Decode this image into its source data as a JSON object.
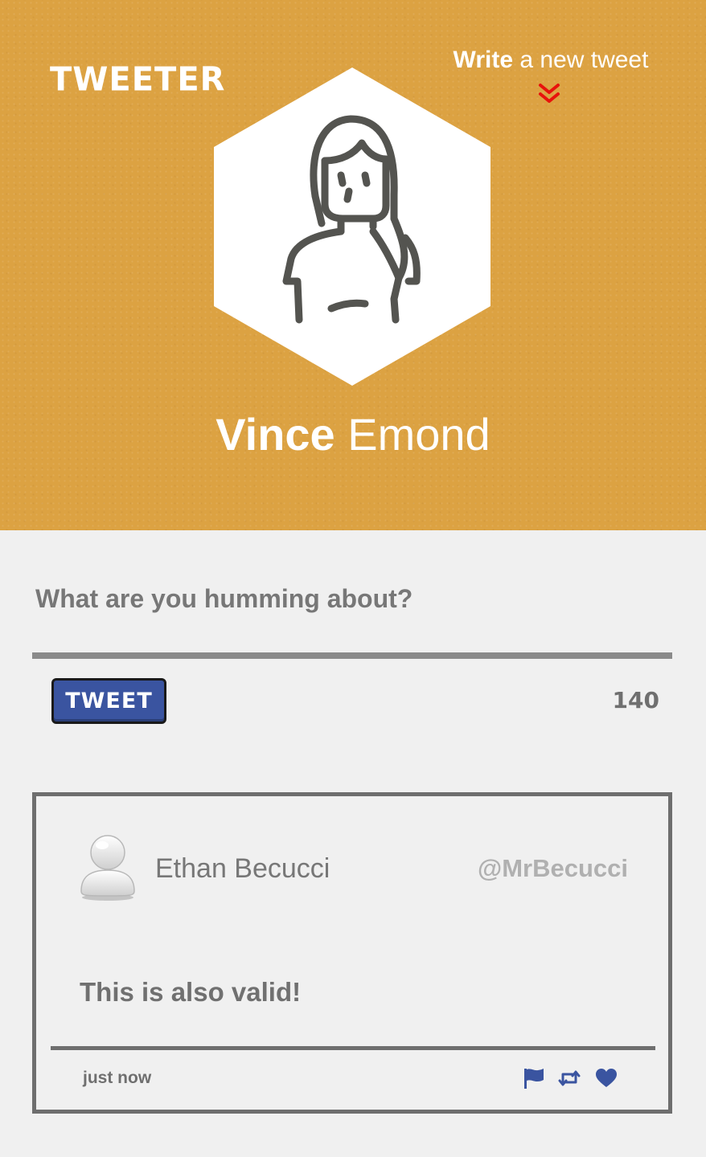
{
  "header": {
    "logo": "TWEETER",
    "write_link": {
      "strong": "Write",
      "rest": " a new tweet"
    },
    "user": {
      "first_name": "Vince",
      "last_name": " Emond"
    }
  },
  "compose": {
    "prompt": "What are you humming about?",
    "input_value": "",
    "tweet_button_label": "TWEET",
    "char_count": "140"
  },
  "tweet": {
    "author": "Ethan Becucci",
    "handle": "@MrBecucci",
    "text": "This is also valid!",
    "time": "just now",
    "actions": [
      "flag-icon",
      "retweet-icon",
      "heart-icon"
    ]
  },
  "colors": {
    "header_bg": "#dca242",
    "page_bg": "#f0f0f0",
    "accent_blue": "#3a54a0",
    "chevron_red": "#e8120c",
    "text_gray": "#777777"
  }
}
